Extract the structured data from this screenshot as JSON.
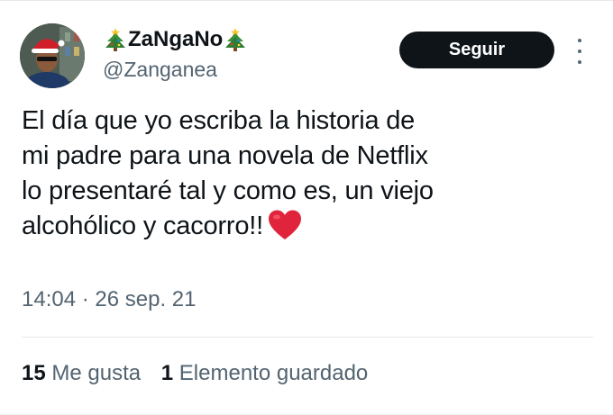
{
  "author": {
    "display_name": "ZaNgaNo",
    "handle": "@Zanganea",
    "decoration_icon": "christmas-tree-icon"
  },
  "follow_button": {
    "label": "Seguir"
  },
  "tweet": {
    "lines": [
      "El día que yo escriba la historia de",
      "mi padre para una novela de Netflix",
      "lo presentaré tal y como es, un viejo",
      "alcohólico y cacorro!!"
    ],
    "emoji": "red-heart"
  },
  "meta": {
    "time": "14:04",
    "separator": "·",
    "date": "26 sep. 21"
  },
  "stats": {
    "likes": {
      "count": "15",
      "label": "Me gusta"
    },
    "bookmarks": {
      "count": "1",
      "label": "Elemento guardado"
    }
  },
  "colors": {
    "text": "#0f1419",
    "secondary": "#536471",
    "button": "#0f1419",
    "heart": "#e0243b",
    "border": "#e7e9ea"
  }
}
